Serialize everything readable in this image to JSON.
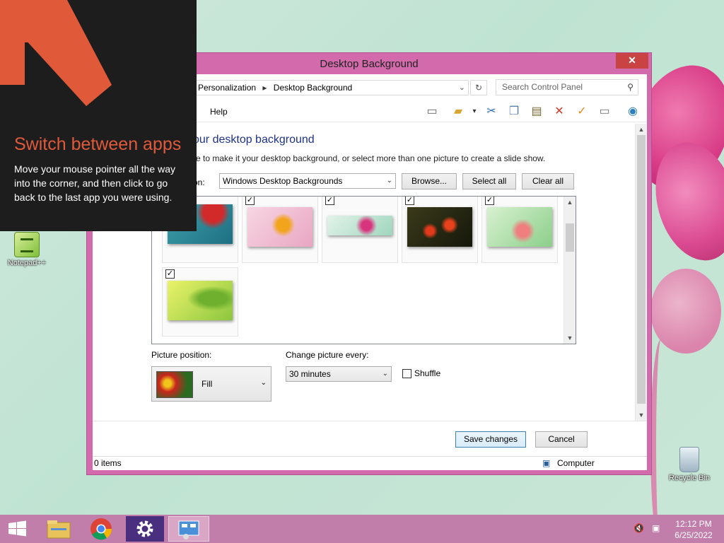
{
  "desktop": {
    "icons": [
      {
        "label": "Notepad++",
        "icon": "notepad-plus-icon"
      },
      {
        "label": "Recycle Bin",
        "icon": "recycle-bin-icon"
      }
    ]
  },
  "window": {
    "title": "Desktop Background",
    "address": {
      "crumbs": [
        "Personalization",
        "Desktop Background"
      ]
    },
    "search": {
      "placeholder": "Search Control Panel"
    },
    "menu": {
      "help": "Help"
    },
    "toolbar_icons": [
      "layout-icon",
      "folder-icon",
      "cut-icon",
      "copy-icon",
      "paste-icon",
      "delete-icon",
      "properties-check-icon",
      "rename-icon",
      "globe-icon"
    ],
    "heading": "our desktop background",
    "subtext": "re to make it your desktop background, or select more than one picture to create a slide show.",
    "location": {
      "label": "tion:",
      "value": "Windows Desktop Backgrounds"
    },
    "buttons": {
      "browse": "Browse...",
      "select_all": "Select all",
      "clear_all": "Clear all",
      "save": "Save changes",
      "cancel": "Cancel"
    },
    "pictures": [
      {
        "checked": true,
        "theme": "red flower on teal"
      },
      {
        "checked": true,
        "theme": "orange flower on pink"
      },
      {
        "checked": true,
        "theme": "pink flower on mint"
      },
      {
        "checked": true,
        "theme": "red tulips dark"
      },
      {
        "checked": true,
        "theme": "pink lily on green"
      },
      {
        "checked": true,
        "theme": "green leaves"
      }
    ],
    "picture_position": {
      "label": "Picture position:",
      "value": "Fill"
    },
    "change_every": {
      "label": "Change picture every:",
      "value": "30 minutes"
    },
    "shuffle": {
      "label": "Shuffle",
      "checked": false
    },
    "status": {
      "items": "0 items",
      "location": "Computer"
    }
  },
  "overlay": {
    "title": "Switch between apps",
    "body": "Move your mouse pointer all the way into the corner, and then click to go back to the last app you were using."
  },
  "taskbar": {
    "items": [
      "windows-start-icon",
      "file-explorer-icon",
      "chrome-icon",
      "settings-icon",
      "control-panel-icon"
    ],
    "clock": {
      "time": "12:12 PM",
      "date": "6/25/2022"
    }
  }
}
